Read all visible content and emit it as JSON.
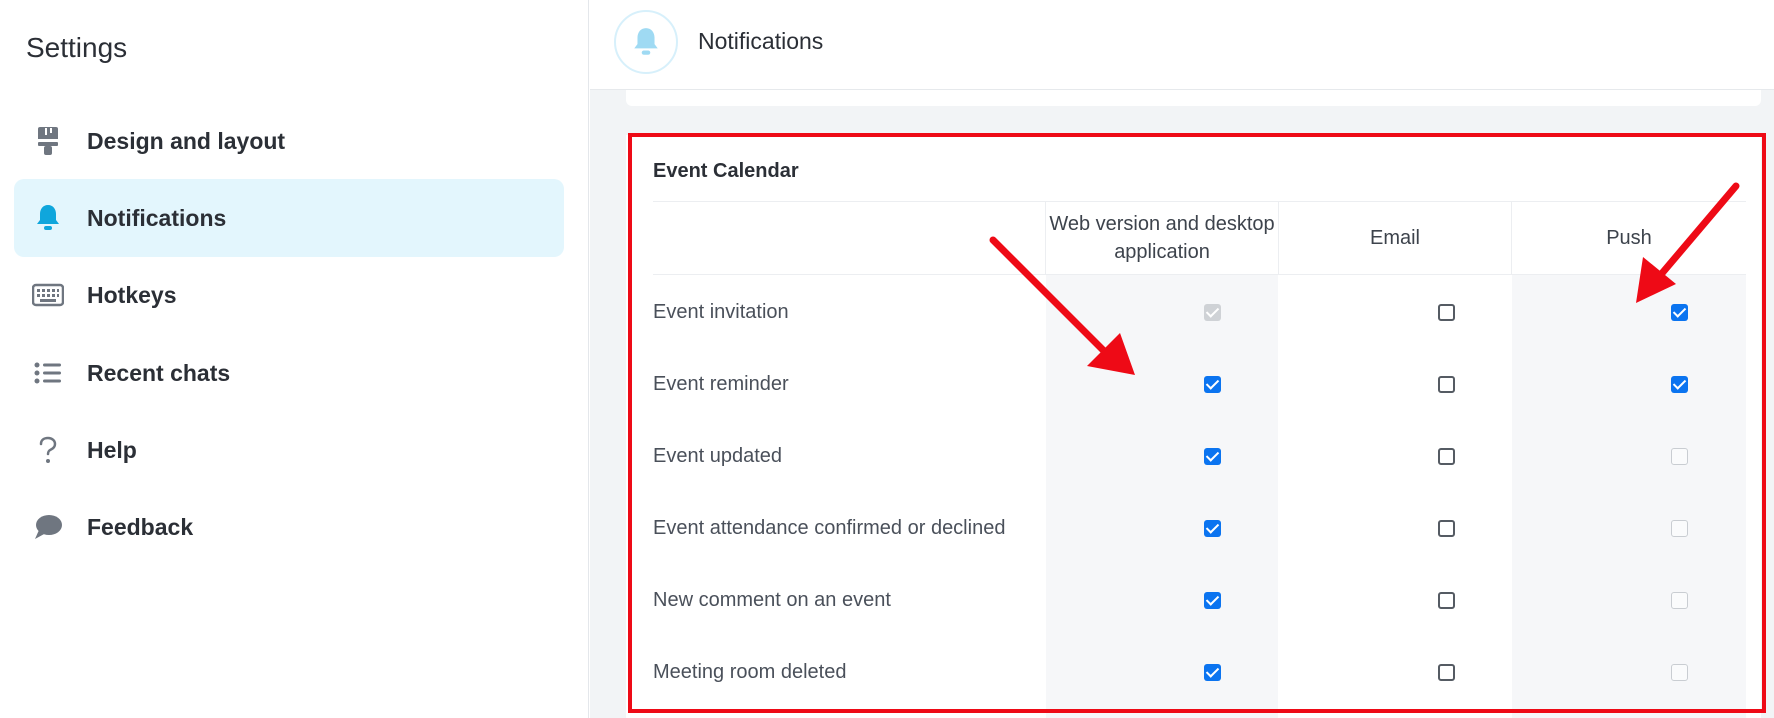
{
  "sidebar": {
    "title": "Settings",
    "items": [
      {
        "label": "Design and layout",
        "icon": "paint-brush-icon",
        "active": false
      },
      {
        "label": "Notifications",
        "icon": "bell-icon",
        "active": true
      },
      {
        "label": "Hotkeys",
        "icon": "keyboard-icon",
        "active": false
      },
      {
        "label": "Recent chats",
        "icon": "list-icon",
        "active": false
      },
      {
        "label": "Help",
        "icon": "question-icon",
        "active": false
      },
      {
        "label": "Feedback",
        "icon": "speech-bubble-icon",
        "active": false
      }
    ]
  },
  "header": {
    "title": "Notifications",
    "icon": "bell-icon"
  },
  "section": {
    "title": "Event Calendar",
    "columns": [
      "Web version and desktop application",
      "Email",
      "Push"
    ],
    "rows": [
      {
        "label": "Event invitation",
        "web": "disabled-checked",
        "email": "unchecked",
        "push": "checked"
      },
      {
        "label": "Event reminder",
        "web": "checked",
        "email": "unchecked",
        "push": "checked"
      },
      {
        "label": "Event updated",
        "web": "checked",
        "email": "unchecked",
        "push": "disabled"
      },
      {
        "label": "Event attendance confirmed or declined",
        "web": "checked",
        "email": "unchecked",
        "push": "disabled"
      },
      {
        "label": "New comment on an event",
        "web": "checked",
        "email": "unchecked",
        "push": "disabled"
      },
      {
        "label": "Meeting room deleted",
        "web": "checked",
        "email": "unchecked",
        "push": "disabled"
      }
    ]
  },
  "colors": {
    "accent": "#0b74f0",
    "active_bg": "#e3f6fd",
    "icon_blue": "#0fa6dc",
    "annotation": "#ee0a16"
  }
}
